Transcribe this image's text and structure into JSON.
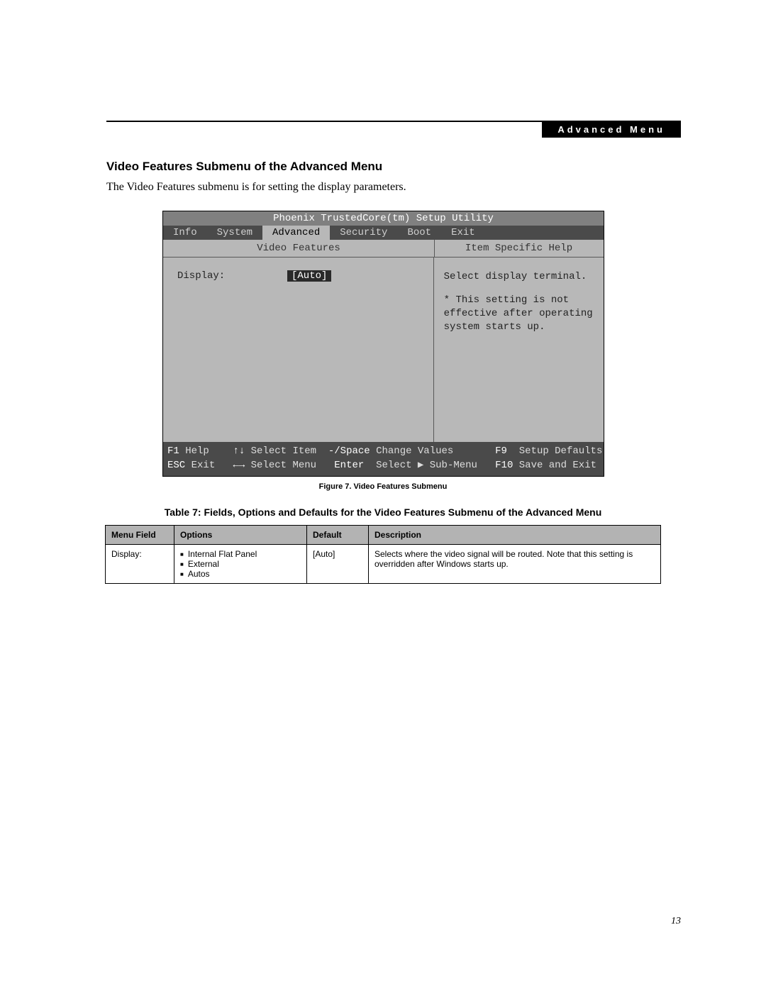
{
  "breadcrumb": "Advanced Menu",
  "heading": "Video Features Submenu of the Advanced Menu",
  "intro": "The Video Features submenu is for setting the display parameters.",
  "bios": {
    "title": "Phoenix TrustedCore(tm) Setup Utility",
    "tabs": [
      "Info",
      "System",
      "Advanced",
      "Security",
      "Boot",
      "Exit"
    ],
    "active_tab": "Advanced",
    "left_title": "Video Features",
    "right_title": "Item Specific Help",
    "field_label": "Display:",
    "field_value": "[Auto]",
    "help_line1": "Select display terminal.",
    "help_rest": "* This setting is not effective after operating system starts up.",
    "footer": {
      "r1": {
        "k1": "F1",
        "t1": " Help    ",
        "k2": "↑↓",
        "t2": " Select Item  ",
        "k3": "-/Space",
        "t3": " Change Values       ",
        "k4": "F9",
        "t4": "  Setup Defaults"
      },
      "r2": {
        "k1": "ESC",
        "t1": " Exit   ",
        "k2": "←→",
        "t2": " Select Menu   ",
        "k3": "Enter",
        "t3": "  Select ▶ Sub-Menu   ",
        "k4": "F10",
        "t4": " Save and Exit"
      }
    }
  },
  "figure_caption": "Figure 7.  Video Features Submenu",
  "table_caption": "Table 7: Fields, Options and Defaults for the Video Features Submenu of the Advanced Menu",
  "table": {
    "headers": {
      "c1": "Menu Field",
      "c2": "Options",
      "c3": "Default",
      "c4": "Description"
    },
    "row": {
      "field": "Display:",
      "options": [
        "Internal Flat Panel",
        "External",
        "Autos"
      ],
      "default": "[Auto]",
      "description": "Selects where the video signal will be routed. Note that this setting is overridden after Windows starts up."
    }
  },
  "page_number": "13"
}
